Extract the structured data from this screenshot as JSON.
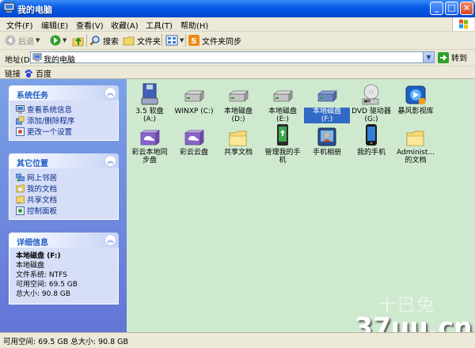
{
  "window": {
    "title": "我的电脑"
  },
  "menu": [
    "文件(F)",
    "编辑(E)",
    "查看(V)",
    "收藏(A)",
    "工具(T)",
    "帮助(H)"
  ],
  "toolbar": {
    "back": "后退",
    "search": "搜索",
    "folders": "文件夹",
    "sync": "文件夹同步"
  },
  "address": {
    "label": "地址(D)",
    "value": "我的电脑",
    "go": "转到"
  },
  "links": {
    "label": "链接",
    "item": "百度"
  },
  "panels": {
    "system": {
      "title": "系统任务",
      "items": [
        "查看系统信息",
        "添加/删除程序",
        "更改一个设置"
      ]
    },
    "other": {
      "title": "其它位置",
      "items": [
        "网上邻居",
        "我的文档",
        "共享文档",
        "控制面板"
      ]
    },
    "details": {
      "title": "详细信息",
      "name": "本地磁盘 (F:)",
      "type": "本地磁盘",
      "fs": "文件系统: NTFS",
      "free": "可用空间: 69.5 GB",
      "total": "总大小: 90.8 GB"
    }
  },
  "items": [
    {
      "label": "3.5 软盘\n(A:)",
      "icon": "floppy-icon"
    },
    {
      "label": "WINXP (C:)",
      "icon": "harddrive-icon"
    },
    {
      "label": "本地磁盘\n(D:)",
      "icon": "harddrive-icon"
    },
    {
      "label": "本地磁盘\n(E:)",
      "icon": "harddrive-icon"
    },
    {
      "label": "本地磁盘\n(F:)",
      "icon": "harddrive-icon",
      "selected": true
    },
    {
      "label": "DVD 驱动器\n(G:)",
      "icon": "dvd-icon"
    },
    {
      "label": "暴风影视库",
      "icon": "baofeng-icon"
    },
    {
      "label": "彩云本地同\n步盘",
      "icon": "cloud-sync-icon"
    },
    {
      "label": "彩云云盘",
      "icon": "cloud-disk-icon"
    },
    {
      "label": "共享文档",
      "icon": "folder-icon"
    },
    {
      "label": "管理我的手\n机",
      "icon": "phone-manager-icon"
    },
    {
      "label": "手机相册",
      "icon": "phone-album-icon"
    },
    {
      "label": "我的手机",
      "icon": "phone-icon"
    },
    {
      "label": "Administ...\n的文档",
      "icon": "folder-icon"
    }
  ],
  "status": {
    "text": "可用空间: 69.5 GB 总大小: 90.8 GB"
  },
  "watermark": {
    "main": "37uu.cn",
    "faint": "十巴兔"
  }
}
